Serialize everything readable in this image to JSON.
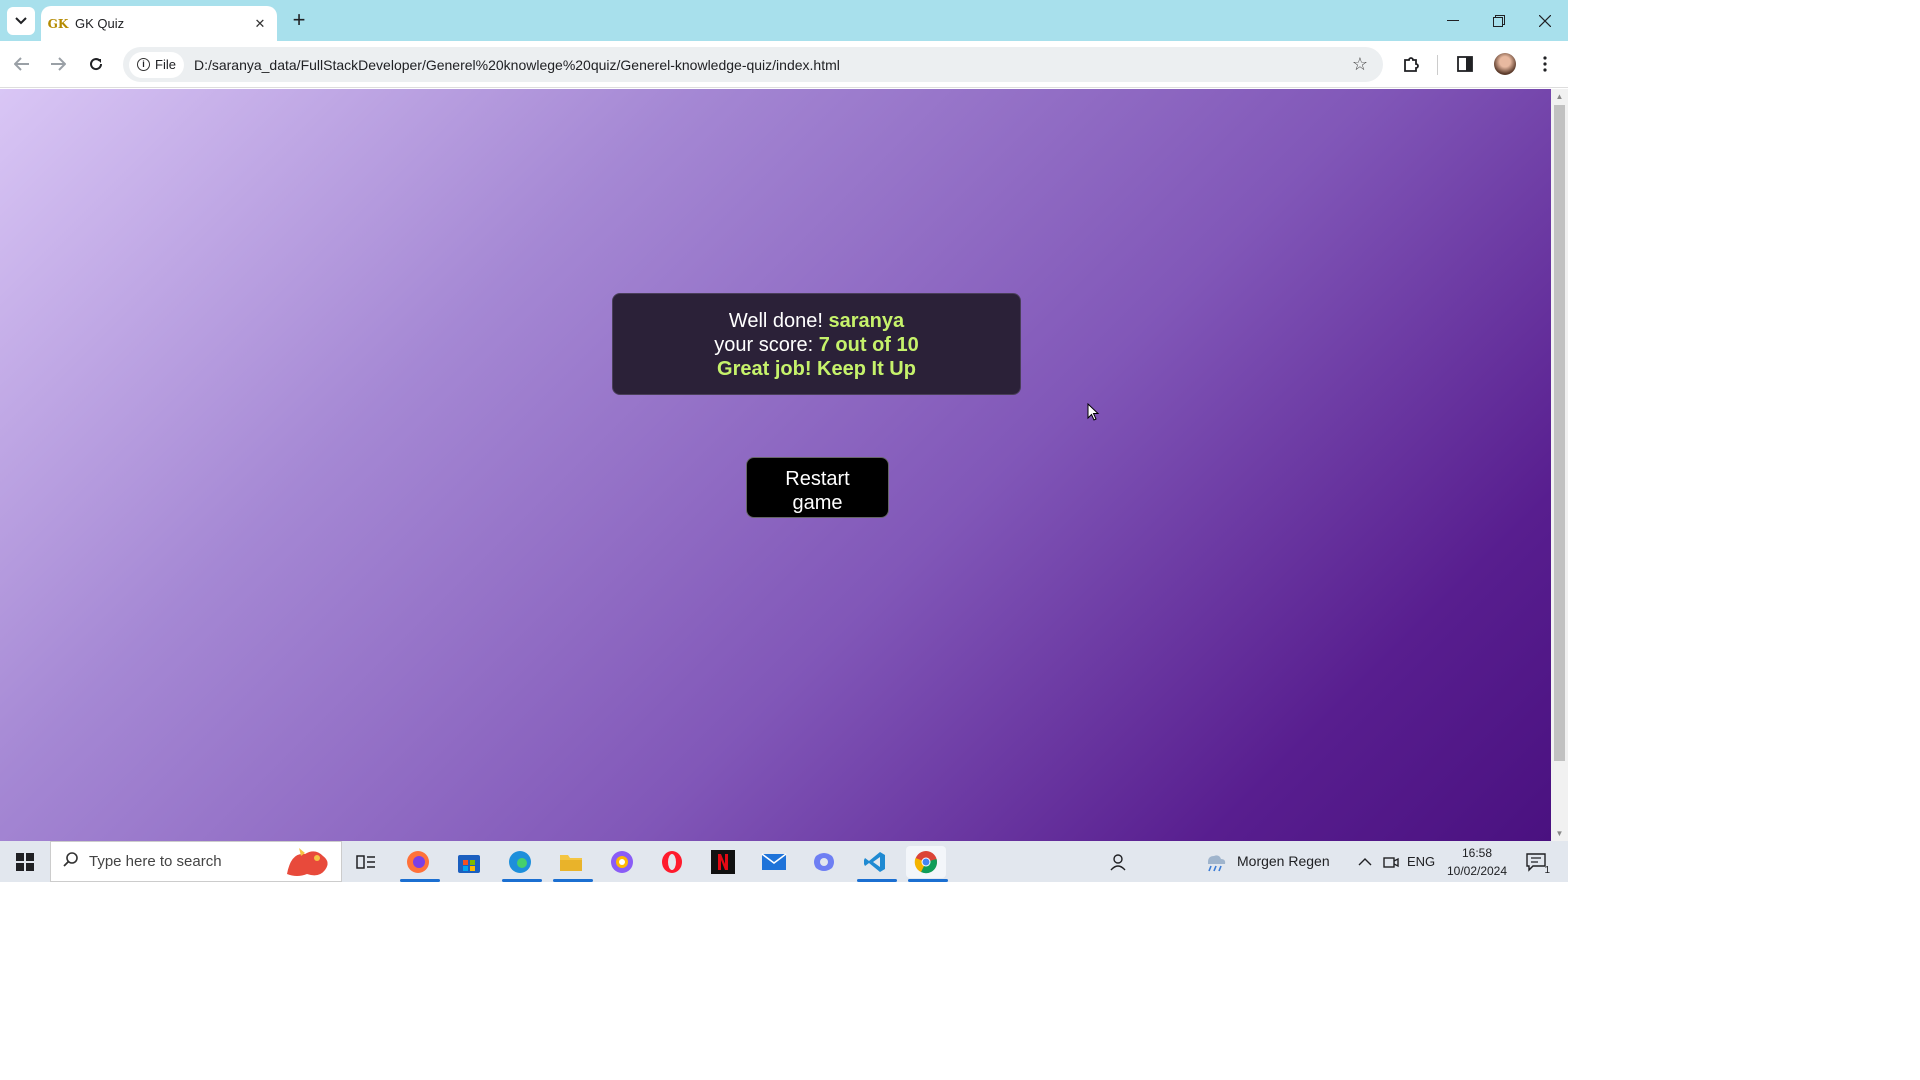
{
  "browser": {
    "tab_title": "GK Quiz",
    "tab_favicon_text": "GK",
    "site_chip_label": "File",
    "url": "D:/saranya_data/FullStackDeveloper/Generel%20knowlege%20quiz/Generel-knowledge-quiz/index.html"
  },
  "result": {
    "well_done_prefix": "Well done!",
    "player_name": "saranya",
    "score_prefix": "your score:",
    "score_value": "7 out of 10",
    "message": "Great job! Keep It Up"
  },
  "restart_button": {
    "line1": "Restart",
    "line2": "game"
  },
  "taskbar": {
    "search_placeholder": "Type here to search",
    "weather_text": "Morgen Regen",
    "language": "ENG",
    "time": "16:58",
    "date": "10/02/2024",
    "notification_count": "1"
  },
  "colors": {
    "accent_highlight": "#c6f26b",
    "result_box_bg": "#2b2138",
    "button_bg": "#000000",
    "titlebar_bg": "#a8e0ec"
  }
}
